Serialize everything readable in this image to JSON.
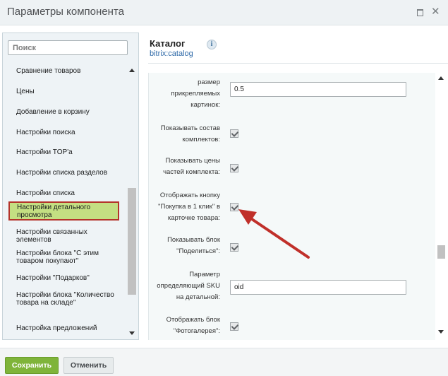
{
  "window": {
    "title": "Параметры компонента"
  },
  "sidebar": {
    "search_placeholder": "Поиск",
    "items": [
      "Сравнение товаров",
      "Цены",
      "Добавление в корзину",
      "Настройки поиска",
      "Настройки TOP'а",
      "Настройки списка разделов",
      "Настройки списка",
      "Настройки детального просмотра",
      "Настройки связанных элементов",
      "Настройки блока \"С этим товаром покупают\"",
      "Настройки \"Подарков\"",
      "Настройки блока \"Количество товара на складе\"",
      "Настройка предложений"
    ],
    "active_index": 7
  },
  "component": {
    "title": "Каталог",
    "code": "bitrix:catalog",
    "info_icon": "i"
  },
  "fields": [
    {
      "label": "размер прикрепляемых картинок:",
      "type": "text",
      "value": "0.5"
    },
    {
      "label": "Показывать состав комплектов:",
      "type": "checkbox",
      "checked": true
    },
    {
      "label": "Показывать цены частей комплекта:",
      "type": "checkbox",
      "checked": true
    },
    {
      "label": "Отображать кнопку \"Покупка в 1 клик\" в карточке товара:",
      "type": "checkbox",
      "checked": true
    },
    {
      "label": "Показывать блок \"Поделиться\":",
      "type": "checkbox",
      "checked": true
    },
    {
      "label": "Параметр определяющий SKU на детальной:",
      "type": "text",
      "value": "oid"
    },
    {
      "label": "Отображать блок \"Фотогалерея\":",
      "type": "checkbox",
      "checked": true
    }
  ],
  "footer": {
    "save_label": "Сохранить",
    "cancel_label": "Отменить"
  },
  "colors": {
    "active_item_bg": "#c4df82",
    "active_item_border": "#b4332a",
    "save_button": "#7fb43a",
    "annotation_arrow": "#c0302a"
  }
}
